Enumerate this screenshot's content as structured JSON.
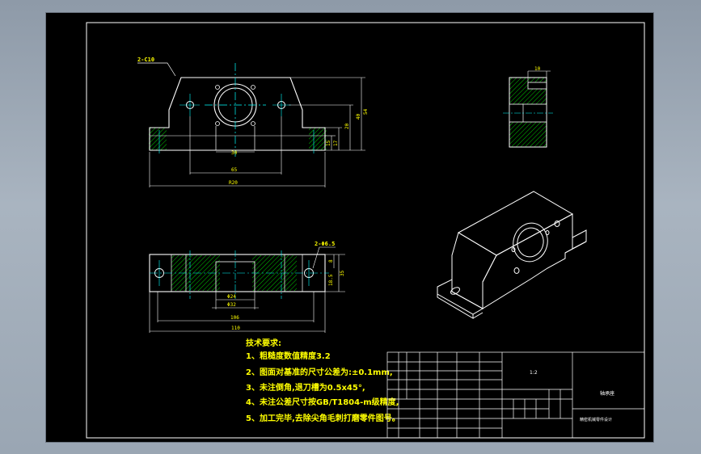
{
  "drawing": {
    "chamfer_note": "2-C10",
    "dim_front": [
      "30",
      "65",
      "R20",
      "15",
      "17",
      "20",
      "40",
      "54"
    ],
    "dim_top": [
      "2-Φ6.5",
      "Φ24",
      "Φ32",
      "106",
      "110",
      "8",
      "18.5",
      "35"
    ],
    "dim_side": "10"
  },
  "technical_requirements": {
    "title": "技术要求:",
    "items": [
      "1、粗糙度数值精度3.2",
      "2、图面对基准的尺寸公差为:±0.1mm,",
      "3、未注倒角,退刀槽为0.5x45°,",
      "4、未注公差尺寸按GB/T1804-m级精度,",
      "5、加工完毕,去除尖角毛刺打磨零件图号。"
    ]
  },
  "title_block": {
    "part_name": "轴承座",
    "scale": "1:2",
    "drawing_name": "精密机械零件设计"
  },
  "colors": {
    "lines": "#ffffff",
    "dimensions": "#ffff00",
    "centerlines": "#00ffff",
    "hatch": "#00c800"
  }
}
